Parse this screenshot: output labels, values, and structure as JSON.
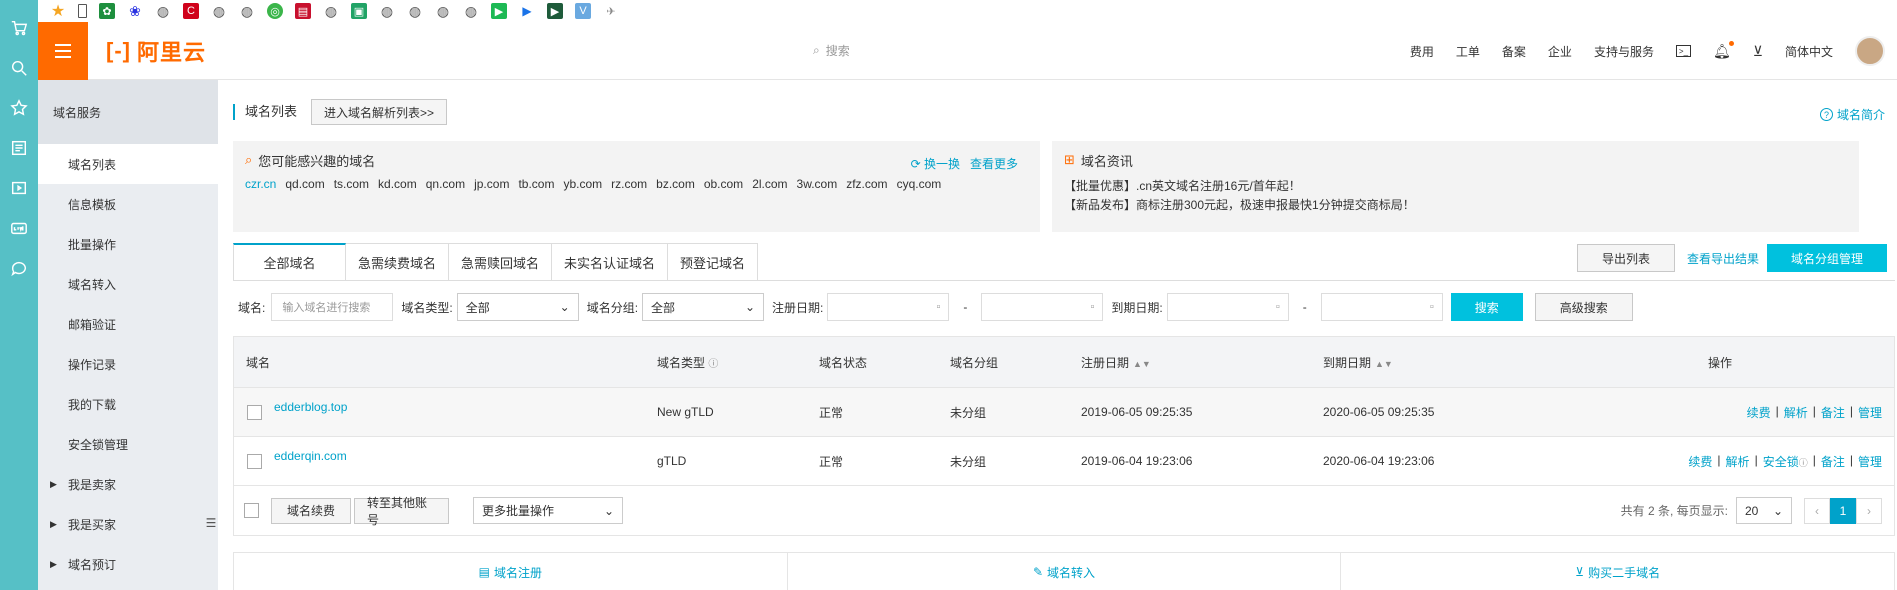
{
  "bookmarks": [
    "star-icon",
    "phone-icon",
    "tree-icon",
    "baidu-icon",
    "globe-icon",
    "c-icon",
    "globe-icon",
    "globe-icon",
    "circle-icon",
    "pdf-icon",
    "globe-icon",
    "green-icon",
    "globe-icon",
    "globe-icon",
    "globe-icon",
    "globe-icon",
    "play-icon",
    "arrow-icon",
    "terminal-icon",
    "vue-icon",
    "ufo-icon"
  ],
  "header": {
    "logo_text": "阿里云",
    "search_placeholder": "搜索",
    "nav": [
      "费用",
      "工单",
      "备案",
      "企业",
      "支持与服务"
    ],
    "language": "简体中文"
  },
  "sidebar": {
    "title": "域名服务",
    "items": [
      {
        "label": "域名列表",
        "active": true
      },
      {
        "label": "信息模板"
      },
      {
        "label": "批量操作"
      },
      {
        "label": "域名转入"
      },
      {
        "label": "邮箱验证"
      },
      {
        "label": "操作记录"
      },
      {
        "label": "我的下载"
      },
      {
        "label": "安全锁管理"
      },
      {
        "label": "我是卖家",
        "expandable": true
      },
      {
        "label": "我是买家",
        "expandable": true
      },
      {
        "label": "域名预订",
        "expandable": true
      }
    ]
  },
  "page": {
    "title": "域名列表",
    "goto_dns_button": "进入域名解析列表>>",
    "help_link": "域名简介"
  },
  "interest": {
    "title": "您可能感兴趣的域名",
    "refresh": "换一换",
    "more": "查看更多",
    "domains": [
      "czr.cn",
      "qd.com",
      "ts.com",
      "kd.com",
      "qn.com",
      "jp.com",
      "tb.com",
      "yb.com",
      "rz.com",
      "bz.com",
      "ob.com",
      "2l.com",
      "3w.com",
      "zfz.com",
      "cyq.com"
    ]
  },
  "news": {
    "title": "域名资讯",
    "lines": [
      "【批量优惠】.cn英文域名注册16元/首年起！",
      "【新品发布】商标注册300元起，极速申报最快1分钟提交商标局！"
    ]
  },
  "tabs": [
    "全部域名",
    "急需续费域名",
    "急需赎回域名",
    "未实名认证域名",
    "预登记域名"
  ],
  "actions": {
    "export": "导出列表",
    "view_export": "查看导出结果",
    "group_manage": "域名分组管理"
  },
  "filters": {
    "domain_label": "域名:",
    "domain_placeholder": "输入域名进行搜索",
    "type_label": "域名类型:",
    "type_value": "全部",
    "group_label": "域名分组:",
    "group_value": "全部",
    "reg_label": "注册日期:",
    "exp_label": "到期日期:",
    "dash": "-",
    "search": "搜索",
    "advanced": "高级搜索"
  },
  "table": {
    "headers": {
      "domain": "域名",
      "type": "域名类型",
      "status": "域名状态",
      "group": "域名分组",
      "reg": "注册日期",
      "exp": "到期日期",
      "ops": "操作"
    },
    "rows": [
      {
        "domain": "edderblog.top",
        "type": "New gTLD",
        "status": "正常",
        "group": "未分组",
        "reg": "2019-06-05 09:25:35",
        "exp": "2020-06-05 09:25:35",
        "ops": [
          "续费",
          "解析",
          "备注",
          "管理"
        ]
      },
      {
        "domain": "edderqin.com",
        "type": "gTLD",
        "status": "正常",
        "group": "未分组",
        "reg": "2019-06-04 19:23:06",
        "exp": "2020-06-04 19:23:06",
        "ops": [
          "续费",
          "解析",
          "安全锁",
          "备注",
          "管理"
        ]
      }
    ],
    "footer": {
      "renew": "域名续费",
      "transfer": "转至其他账号",
      "more_batch": "更多批量操作",
      "total": "共有 2 条, 每页显示:",
      "page_size": "20",
      "current_page": "1"
    }
  },
  "bottom_links": [
    "域名注册",
    "域名转入",
    "购买二手域名"
  ]
}
